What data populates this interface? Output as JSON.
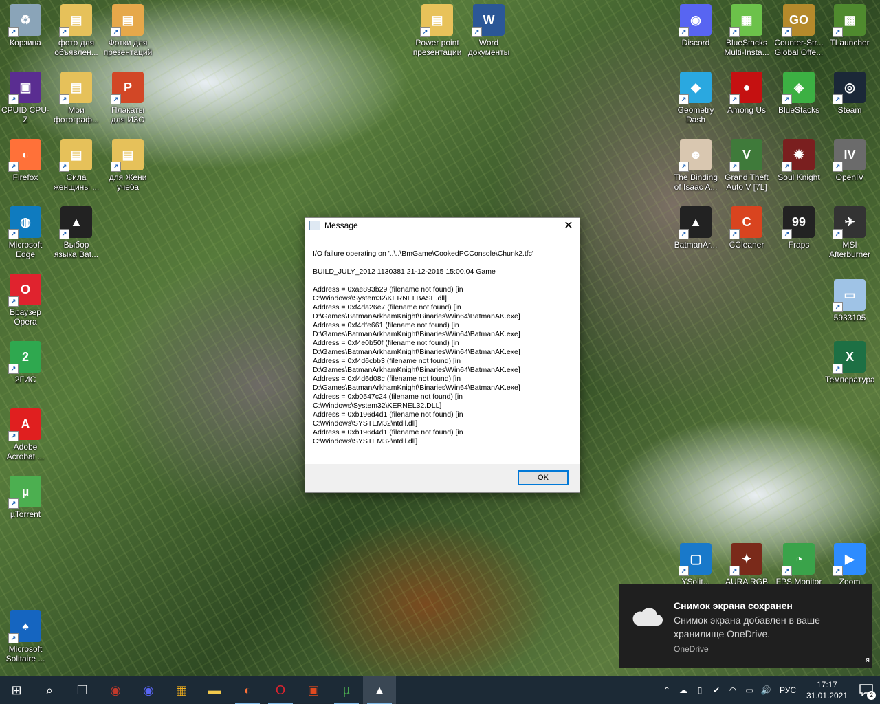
{
  "desktop_icons": [
    {
      "label": "Корзина",
      "glyph": "♻",
      "color": "#8aa4b8"
    },
    {
      "label": "фото для объявлен...",
      "glyph": "▤",
      "color": "#e6c15a"
    },
    {
      "label": "Фотки для презентаций",
      "glyph": "▤",
      "color": "#e6a84a"
    },
    {
      "label": "Power point презентации",
      "glyph": "▤",
      "color": "#e8c25a"
    },
    {
      "label": "Word документы",
      "glyph": "W",
      "color": "#2b5797"
    },
    {
      "label": "Discord",
      "glyph": "◉",
      "color": "#5865f2"
    },
    {
      "label": "BlueStacks Multi-Insta...",
      "glyph": "▦",
      "color": "#6cc24a"
    },
    {
      "label": "Counter-Str... Global Offe...",
      "glyph": "GO",
      "color": "#b58a2b"
    },
    {
      "label": "TLauncher",
      "glyph": "▩",
      "color": "#4f8a2e"
    },
    {
      "label": "CPUID CPU-Z",
      "glyph": "▣",
      "color": "#5a2d91"
    },
    {
      "label": "Мои фотограф...",
      "glyph": "▤",
      "color": "#e6c15a"
    },
    {
      "label": "Плакаты для ИЗО",
      "glyph": "P",
      "color": "#d24726"
    },
    {
      "label": "Geometry Dash",
      "glyph": "◆",
      "color": "#2aa8e0"
    },
    {
      "label": "Among Us",
      "glyph": "●",
      "color": "#c51111"
    },
    {
      "label": "BlueStacks",
      "glyph": "◈",
      "color": "#3cb043"
    },
    {
      "label": "Steam",
      "glyph": "◎",
      "color": "#1b2838"
    },
    {
      "label": "Firefox",
      "glyph": "◐",
      "color": "#ff7139"
    },
    {
      "label": "Сила женщины ...",
      "glyph": "▤",
      "color": "#e6c15a"
    },
    {
      "label": "для Жени учеба",
      "glyph": "▤",
      "color": "#e6c15a"
    },
    {
      "label": "The Binding of Isaac A...",
      "glyph": "☻",
      "color": "#d9c7b0"
    },
    {
      "label": "Grand Theft Auto V [7L]",
      "glyph": "V",
      "color": "#3f7a3a"
    },
    {
      "label": "Soul Knight",
      "glyph": "✹",
      "color": "#7a1f1f"
    },
    {
      "label": "OpenIV",
      "glyph": "IV",
      "color": "#6b6b6b"
    },
    {
      "label": "Microsoft Edge",
      "glyph": "◍",
      "color": "#0f7bbf"
    },
    {
      "label": "Выбор языка Bat...",
      "glyph": "▲",
      "color": "#222222"
    },
    {
      "label": "BatmanAr...",
      "glyph": "▲",
      "color": "#222222"
    },
    {
      "label": "CCleaner",
      "glyph": "C",
      "color": "#d9441f"
    },
    {
      "label": "Fraps",
      "glyph": "99",
      "color": "#222222"
    },
    {
      "label": "MSI Afterburner",
      "glyph": "✈",
      "color": "#333333"
    },
    {
      "label": "Браузер Opera",
      "glyph": "O",
      "color": "#e0232e"
    },
    {
      "label": "5933105",
      "glyph": "▭",
      "color": "#9fc3e6"
    },
    {
      "label": "2ГИС",
      "glyph": "2",
      "color": "#2fa84f"
    },
    {
      "label": "Температура",
      "glyph": "X",
      "color": "#1d7044"
    },
    {
      "label": "Adobe Acrobat ...",
      "glyph": "A",
      "color": "#e01f1f"
    },
    {
      "label": "µTorrent",
      "glyph": "µ",
      "color": "#4caf50"
    },
    {
      "label": "YSolit...",
      "glyph": "▢",
      "color": "#1979ca"
    },
    {
      "label": "AURA RGB",
      "glyph": "✦",
      "color": "#7a2a1a"
    },
    {
      "label": "FPS Monitor",
      "glyph": "◔",
      "color": "#3aa34a"
    },
    {
      "label": "Zoom",
      "glyph": "▶",
      "color": "#2d8cff"
    },
    {
      "label": "Microsoft Solitaire ...",
      "glyph": "♠",
      "color": "#1565c0"
    }
  ],
  "dialog": {
    "title": "Message",
    "close_glyph": "✕",
    "line1": "I/O failure operating on '..\\..\\BmGame\\CookedPCConsole\\Chunk2.tfc'",
    "line2": "BUILD_JULY_2012 1130381 21-12-2015 15:00.04 Game",
    "addresses": "Address = 0xae893b29 (filename not found) [in\nC:\\Windows\\System32\\KERNELBASE.dll]\nAddress = 0xf4da26e7 (filename not found) [in\nD:\\Games\\BatmanArkhamKnight\\Binaries\\Win64\\BatmanAK.exe]\nAddress = 0xf4dfe661 (filename not found) [in\nD:\\Games\\BatmanArkhamKnight\\Binaries\\Win64\\BatmanAK.exe]\nAddress = 0xf4e0b50f (filename not found) [in\nD:\\Games\\BatmanArkhamKnight\\Binaries\\Win64\\BatmanAK.exe]\nAddress = 0xf4d6cbb3 (filename not found) [in\nD:\\Games\\BatmanArkhamKnight\\Binaries\\Win64\\BatmanAK.exe]\nAddress = 0xf4d6d08c (filename not found) [in\nD:\\Games\\BatmanArkhamKnight\\Binaries\\Win64\\BatmanAK.exe]\nAddress = 0xb0547c24 (filename not found) [in\nC:\\Windows\\System32\\KERNEL32.DLL]\nAddress = 0xb196d4d1 (filename not found) [in\nC:\\Windows\\SYSTEM32\\ntdll.dll]\nAddress = 0xb196d4d1 (filename not found) [in\nC:\\Windows\\SYSTEM32\\ntdll.dll]",
    "ok_label": "OK"
  },
  "toast": {
    "title": "Снимок экрана сохранен",
    "body": "Снимок экрана добавлен в ваше хранилище OneDrive.",
    "source": "OneDrive",
    "edge_char": "я"
  },
  "taskbar": {
    "apps": [
      {
        "name": "start-button",
        "glyph": "⊞",
        "color": "#ffffff"
      },
      {
        "name": "search-icon",
        "glyph": "⌕",
        "color": "#ffffff"
      },
      {
        "name": "task-view-icon",
        "glyph": "❐",
        "color": "#ffffff"
      },
      {
        "name": "game-app-icon",
        "glyph": "◉",
        "color": "#c0392b"
      },
      {
        "name": "discord-icon",
        "glyph": "◉",
        "color": "#5865f2"
      },
      {
        "name": "store-icon",
        "glyph": "▦",
        "color": "#f2b01e"
      },
      {
        "name": "file-explorer-icon",
        "glyph": "▬",
        "color": "#f2c94c"
      },
      {
        "name": "firefox-icon",
        "glyph": "◐",
        "color": "#ff7139"
      },
      {
        "name": "opera-icon",
        "glyph": "O",
        "color": "#e0232e"
      },
      {
        "name": "office-icon",
        "glyph": "▣",
        "color": "#e04a1f"
      },
      {
        "name": "utorrent-icon",
        "glyph": "µ",
        "color": "#4caf50"
      },
      {
        "name": "batman-app-icon",
        "glyph": "▲",
        "color": "#ffffff"
      }
    ],
    "tray_glyphs": [
      "⌃",
      "☁",
      "▯",
      "✔",
      "◠",
      "▭",
      "🔊"
    ],
    "language": "РУС",
    "time": "17:17",
    "date": "31.01.2021",
    "notification_count": "2"
  }
}
